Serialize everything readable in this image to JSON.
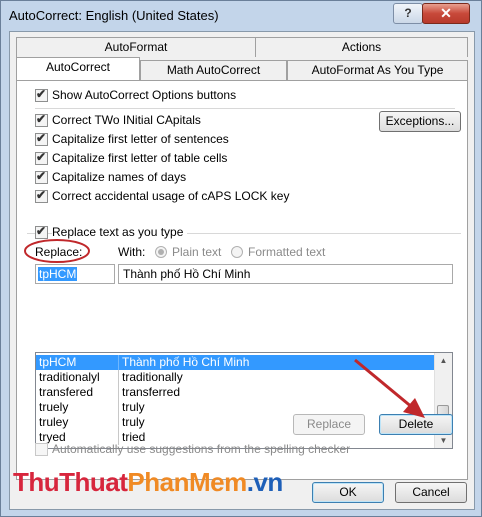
{
  "window": {
    "title": "AutoCorrect: English (United States)",
    "help_label": "?",
    "close_label": "✕"
  },
  "tabs": {
    "autoformat": "AutoFormat",
    "actions": "Actions",
    "autocorrect": "AutoCorrect",
    "math_autocorrect": "Math AutoCorrect",
    "autoformat_as_you_type": "AutoFormat As You Type"
  },
  "options": {
    "show_buttons": "Show AutoCorrect Options buttons",
    "two_initial_caps": "Correct TWo INitial CApitals",
    "cap_sentences": "Capitalize first letter of sentences",
    "cap_table_cells": "Capitalize first letter of table cells",
    "cap_days": "Capitalize names of days",
    "caps_lock": "Correct accidental usage of cAPS LOCK key",
    "exceptions_button": "Exceptions...",
    "replace_as_type": "Replace text as you type"
  },
  "replace_section": {
    "replace_label": "Replace:",
    "with_label": "With:",
    "plain_text": "Plain text",
    "formatted_text": "Formatted text",
    "replace_value": "tpHCM",
    "with_value": "Thành phố Hồ Chí Minh"
  },
  "entries": [
    {
      "from": "tpHCM",
      "to": "Thành phố Hồ Chí Minh"
    },
    {
      "from": "traditionalyl",
      "to": "traditionally"
    },
    {
      "from": "transfered",
      "to": "transferred"
    },
    {
      "from": "truely",
      "to": "truly"
    },
    {
      "from": "truley",
      "to": "truly"
    },
    {
      "from": "tryed",
      "to": "tried"
    }
  ],
  "buttons": {
    "replace": "Replace",
    "delete": "Delete",
    "ok": "OK",
    "cancel": "Cancel"
  },
  "suggestions_option": "Automatically use suggestions from the spelling checker",
  "watermark": {
    "part1": "ThuThuat",
    "part2": "PhanMem",
    "part3": ".vn"
  },
  "colors": {
    "selection": "#3399ff",
    "annotation": "#c0282b"
  }
}
